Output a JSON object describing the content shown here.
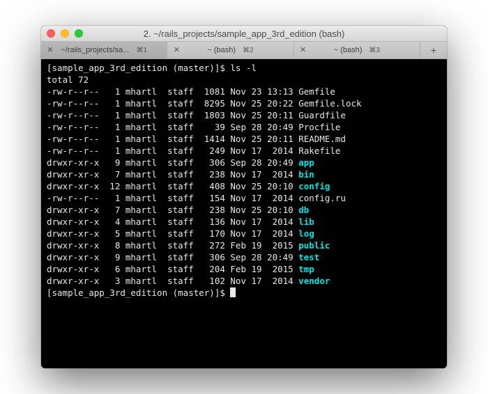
{
  "window": {
    "title": "2. ~/rails_projects/sample_app_3rd_edition (bash)"
  },
  "tabs": [
    {
      "label": "~/rails_projects/sa...",
      "shortcut": "⌘1",
      "active": true
    },
    {
      "label": "~ (bash)",
      "shortcut": "⌘2",
      "active": false
    },
    {
      "label": "~ (bash)",
      "shortcut": "⌘3",
      "active": false
    }
  ],
  "prompt": {
    "text": "[sample_app_3rd_edition (master)]$",
    "command": "ls -l"
  },
  "total_line": "total 72",
  "listing": [
    {
      "perm": "-rw-r--r--",
      "links": "1",
      "owner": "mhartl",
      "group": "staff",
      "size": "1081",
      "date": "Nov 23 13:13",
      "name": "Gemfile",
      "is_dir": false
    },
    {
      "perm": "-rw-r--r--",
      "links": "1",
      "owner": "mhartl",
      "group": "staff",
      "size": "8295",
      "date": "Nov 25 20:22",
      "name": "Gemfile.lock",
      "is_dir": false
    },
    {
      "perm": "-rw-r--r--",
      "links": "1",
      "owner": "mhartl",
      "group": "staff",
      "size": "1803",
      "date": "Nov 25 20:11",
      "name": "Guardfile",
      "is_dir": false
    },
    {
      "perm": "-rw-r--r--",
      "links": "1",
      "owner": "mhartl",
      "group": "staff",
      "size": "39",
      "date": "Sep 28 20:49",
      "name": "Procfile",
      "is_dir": false
    },
    {
      "perm": "-rw-r--r--",
      "links": "1",
      "owner": "mhartl",
      "group": "staff",
      "size": "1414",
      "date": "Nov 25 20:11",
      "name": "README.md",
      "is_dir": false
    },
    {
      "perm": "-rw-r--r--",
      "links": "1",
      "owner": "mhartl",
      "group": "staff",
      "size": "249",
      "date": "Nov 17  2014",
      "name": "Rakefile",
      "is_dir": false
    },
    {
      "perm": "drwxr-xr-x",
      "links": "9",
      "owner": "mhartl",
      "group": "staff",
      "size": "306",
      "date": "Sep 28 20:49",
      "name": "app",
      "is_dir": true
    },
    {
      "perm": "drwxr-xr-x",
      "links": "7",
      "owner": "mhartl",
      "group": "staff",
      "size": "238",
      "date": "Nov 17  2014",
      "name": "bin",
      "is_dir": true
    },
    {
      "perm": "drwxr-xr-x",
      "links": "12",
      "owner": "mhartl",
      "group": "staff",
      "size": "408",
      "date": "Nov 25 20:10",
      "name": "config",
      "is_dir": true
    },
    {
      "perm": "-rw-r--r--",
      "links": "1",
      "owner": "mhartl",
      "group": "staff",
      "size": "154",
      "date": "Nov 17  2014",
      "name": "config.ru",
      "is_dir": false
    },
    {
      "perm": "drwxr-xr-x",
      "links": "7",
      "owner": "mhartl",
      "group": "staff",
      "size": "238",
      "date": "Nov 25 20:10",
      "name": "db",
      "is_dir": true
    },
    {
      "perm": "drwxr-xr-x",
      "links": "4",
      "owner": "mhartl",
      "group": "staff",
      "size": "136",
      "date": "Nov 17  2014",
      "name": "lib",
      "is_dir": true
    },
    {
      "perm": "drwxr-xr-x",
      "links": "5",
      "owner": "mhartl",
      "group": "staff",
      "size": "170",
      "date": "Nov 17  2014",
      "name": "log",
      "is_dir": true
    },
    {
      "perm": "drwxr-xr-x",
      "links": "8",
      "owner": "mhartl",
      "group": "staff",
      "size": "272",
      "date": "Feb 19  2015",
      "name": "public",
      "is_dir": true
    },
    {
      "perm": "drwxr-xr-x",
      "links": "9",
      "owner": "mhartl",
      "group": "staff",
      "size": "306",
      "date": "Sep 28 20:49",
      "name": "test",
      "is_dir": true
    },
    {
      "perm": "drwxr-xr-x",
      "links": "6",
      "owner": "mhartl",
      "group": "staff",
      "size": "204",
      "date": "Feb 19  2015",
      "name": "tmp",
      "is_dir": true
    },
    {
      "perm": "drwxr-xr-x",
      "links": "3",
      "owner": "mhartl",
      "group": "staff",
      "size": "102",
      "date": "Nov 17  2014",
      "name": "vendor",
      "is_dir": true
    }
  ],
  "colors": {
    "dir": "#00e5e5",
    "fg": "#e8e8e8",
    "bg": "#000000"
  }
}
